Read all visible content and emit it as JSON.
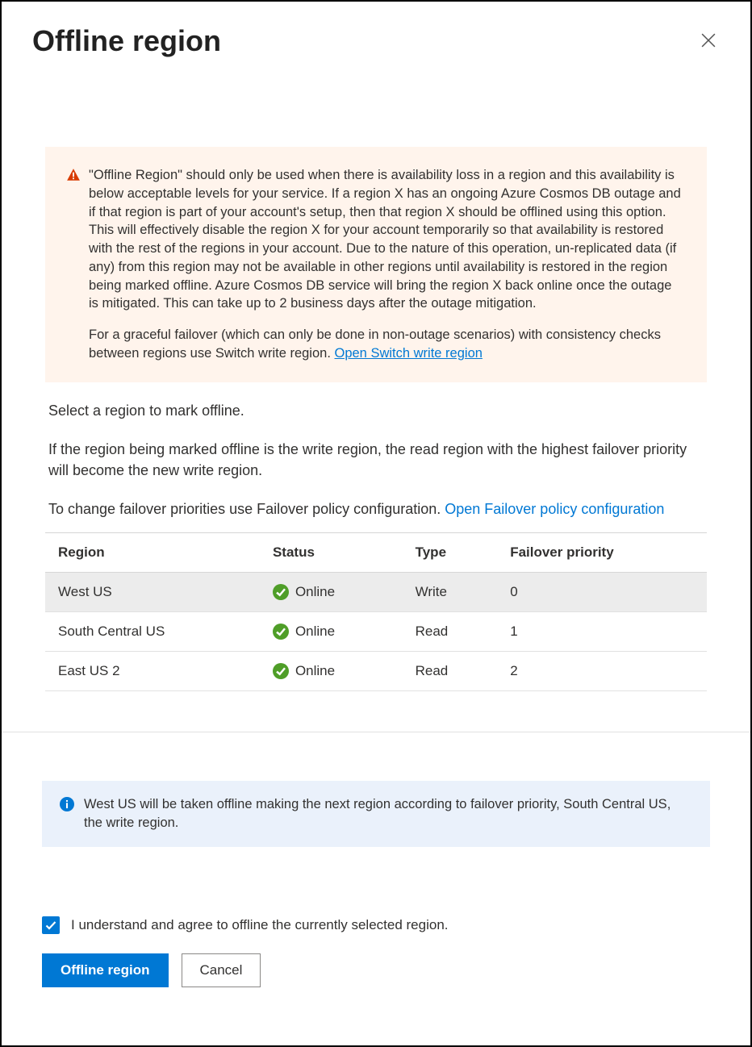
{
  "dialog": {
    "title": "Offline region"
  },
  "warning": {
    "paragraph1": "\"Offline Region\" should only be used when there is availability loss in a region and this availability is below acceptable levels for your service. If a region X has an ongoing Azure Cosmos DB outage and if that region is part of your account's setup, then that region X should be offlined using this option. This will effectively disable the region X for your account temporarily so that availability is restored with the rest of the regions in your account. Due to the nature of this operation, un-replicated data (if any) from this region may not be available in other regions until availability is restored in the region being marked offline. Azure Cosmos DB service will bring the region X back online once the outage is mitigated. This can take up to 2 business days after the outage mitigation.",
    "paragraph2_prefix": "For a graceful failover (which can only be done in non-outage scenarios) with consistency checks between regions use Switch write region. ",
    "switch_link": "Open Switch write region"
  },
  "instructions": {
    "line1": "Select a region to mark offline.",
    "line2": "If the region being marked offline is the write region, the read region with the highest failover priority will become the new write region.",
    "line3_prefix": "To change failover priorities use Failover policy configuration. ",
    "failover_link": "Open Failover policy configuration"
  },
  "table": {
    "headers": {
      "region": "Region",
      "status": "Status",
      "type": "Type",
      "priority": "Failover priority"
    },
    "rows": [
      {
        "region": "West US",
        "status": "Online",
        "type": "Write",
        "priority": "0",
        "selected": true
      },
      {
        "region": "South Central US",
        "status": "Online",
        "type": "Read",
        "priority": "1",
        "selected": false
      },
      {
        "region": "East US 2",
        "status": "Online",
        "type": "Read",
        "priority": "2",
        "selected": false
      }
    ]
  },
  "info": {
    "text": "West US will be taken offline making the next region according to failover priority, South Central US, the write region."
  },
  "consent": {
    "label": "I understand and agree to offline the currently selected region.",
    "checked": true
  },
  "buttons": {
    "primary": "Offline region",
    "secondary": "Cancel"
  }
}
